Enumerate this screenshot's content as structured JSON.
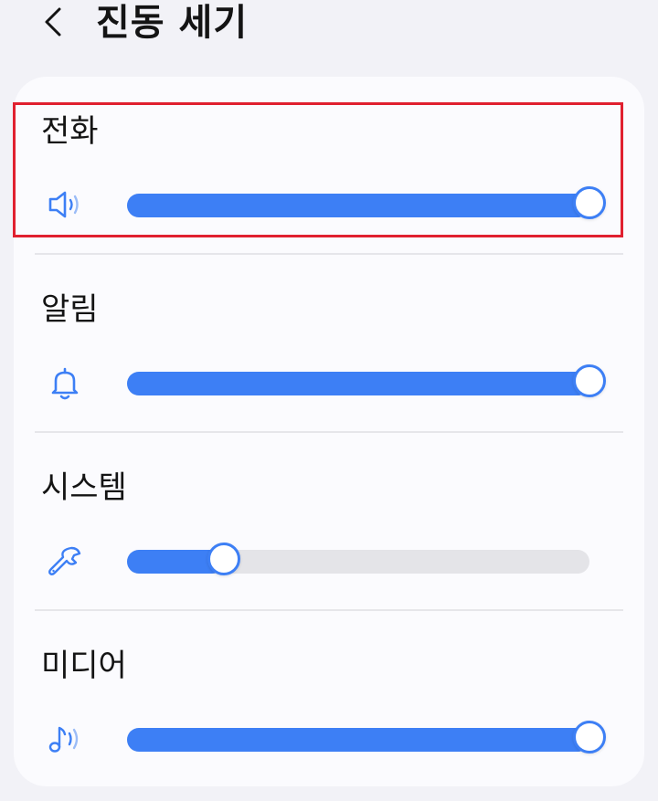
{
  "header": {
    "back_icon": "chevron-left-icon",
    "title": "진동 세기"
  },
  "colors": {
    "accent": "#3d7ff5",
    "track": "#e4e4e8",
    "highlight": "#e0202f",
    "background": "#f2f2f7",
    "card": "#fbfbfe"
  },
  "sliders": [
    {
      "id": "call",
      "label": "전화",
      "icon": "speaker-icon",
      "value": 1.0
    },
    {
      "id": "notification",
      "label": "알림",
      "icon": "bell-icon",
      "value": 1.0
    },
    {
      "id": "system",
      "label": "시스템",
      "icon": "wrench-icon",
      "value": 0.21
    },
    {
      "id": "media",
      "label": "미디어",
      "icon": "music-note-icon",
      "value": 1.0
    }
  ],
  "highlighted_slider": "call"
}
